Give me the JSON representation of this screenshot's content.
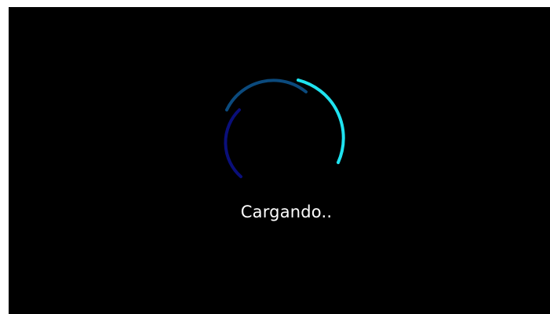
{
  "loader": {
    "text": "Cargando..",
    "colors": {
      "background": "#000000",
      "text": "#ffffff",
      "arc_inner": "#0a0f7a",
      "arc_middle": "#0b4a7d",
      "arc_outer": "#1fe3f0"
    }
  }
}
